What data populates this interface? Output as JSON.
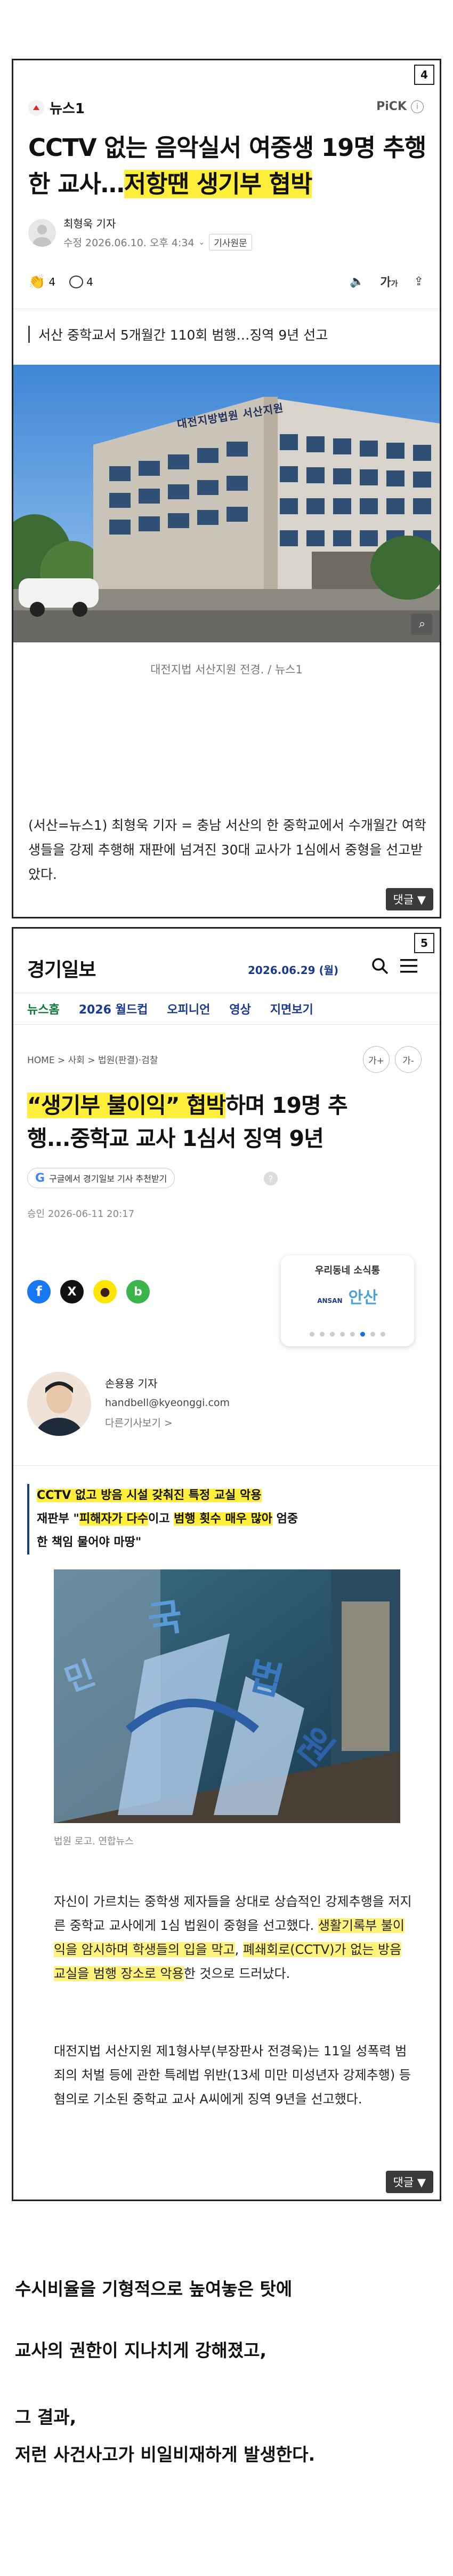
{
  "card1": {
    "page_num": "4",
    "publisher": "뉴스1",
    "pick": "PiCK",
    "title_plain": "CCTV 없는 음악실서 여중생 19명 추행한 교사…",
    "title_highlight": "저항땐 생기부 협박",
    "author": "최형욱 기자",
    "date": "수정 2026.06.10. 오후 4:34",
    "origin_button": "기사원문",
    "like_count": "4",
    "comment_count": "4",
    "subtitle": "서산 중학교서 5개월간 110회 범행…징역 9년 선고",
    "building_sign": "대전지방법원 서산지원",
    "caption": "대전지법 서산지원 전경. / 뉴스1",
    "body": "(서산=뉴스1) 최형욱 기자 = 충남 서산의 한 중학교에서 수개월간 여학생들을 강제 추행해 재판에 넘겨진 30대 교사가 1심에서 중형을 선고받았다.",
    "comment_label": "댓글 ▼"
  },
  "card2": {
    "page_num": "5",
    "logo": "경기일보",
    "date": "2026.06.29 (월)",
    "nav": [
      "뉴스홈",
      "2026 월드컵",
      "오피니언",
      "영상",
      "지면보기"
    ],
    "breadcrumb": "HOME > 사회 > 법원(판결)·검찰",
    "font_up": "가+",
    "font_down": "가-",
    "title_hl": "“생기부 불이익” 협박",
    "title_rest1": "하며 19명 추",
    "title_rest2": "행...중학교 교사 1심서 징역 9년",
    "google_badge": "구글에서 경기일보 기사 추천받기",
    "approved": "승인 2026-06-11 20:17",
    "local_news_title": "우리동네 소식통",
    "local_news_brand": "ANSAN",
    "local_news_brand2": "안산",
    "reporter_name": "손용용 기자",
    "reporter_email": "handbell@kyeonggi.com",
    "reporter_more": "다른기사보기 >",
    "summary_line1": "CCTV 없고 방음 시설 갖춰진 특정 교실 악용",
    "summary_line2a": "재판부 \"",
    "summary_line2b": "피해자가 다수",
    "summary_line2c": "이고 ",
    "summary_line2d": "범행 횟수 매우 많아",
    "summary_line2e": " 엄중",
    "summary_line3": "한 책임 물어야 마땅\"",
    "photo_caption": "법원 로고. 연합뉴스",
    "p1_a": "자신이 가르치는 중학생 제자들을 상대로 상습적인 강제추행을 저지른 중학교 교사에게 1심 법원이 중형을 선고했다. ",
    "p1_b": "생활기록부 불이익을 암시하며 학생들의 입을 막고",
    "p1_c": ", ",
    "p1_d": "폐쇄회로(CCTV)가 없는 방음 교실을 범행 장소로 악용",
    "p1_e": "한 것으로 드러났다.",
    "p2": "대전지법 서산지원 제1형사부(부장판사 전경욱)는 11일 성폭력 범죄의 처벌 등에 관한 특례법 위반(13세 미만 미성년자 강제추행) 등 혐의로 기소된 중학교 교사 A씨에게 징역 9년을 선고했다.",
    "comment_label": "댓글 ▼"
  },
  "footer": {
    "line1": "수시비율을 기형적으로 높여놓은 탓에",
    "line2": "교사의 권한이 지나치게 강해졌고,",
    "line3": "그 결과,",
    "line4": "저런 사건사고가 비일비재하게 발생한다."
  },
  "colors": {
    "highlight": "#ffef3a",
    "nav_blue": "#1a3a8f",
    "link_green": "#0a7a3a"
  }
}
